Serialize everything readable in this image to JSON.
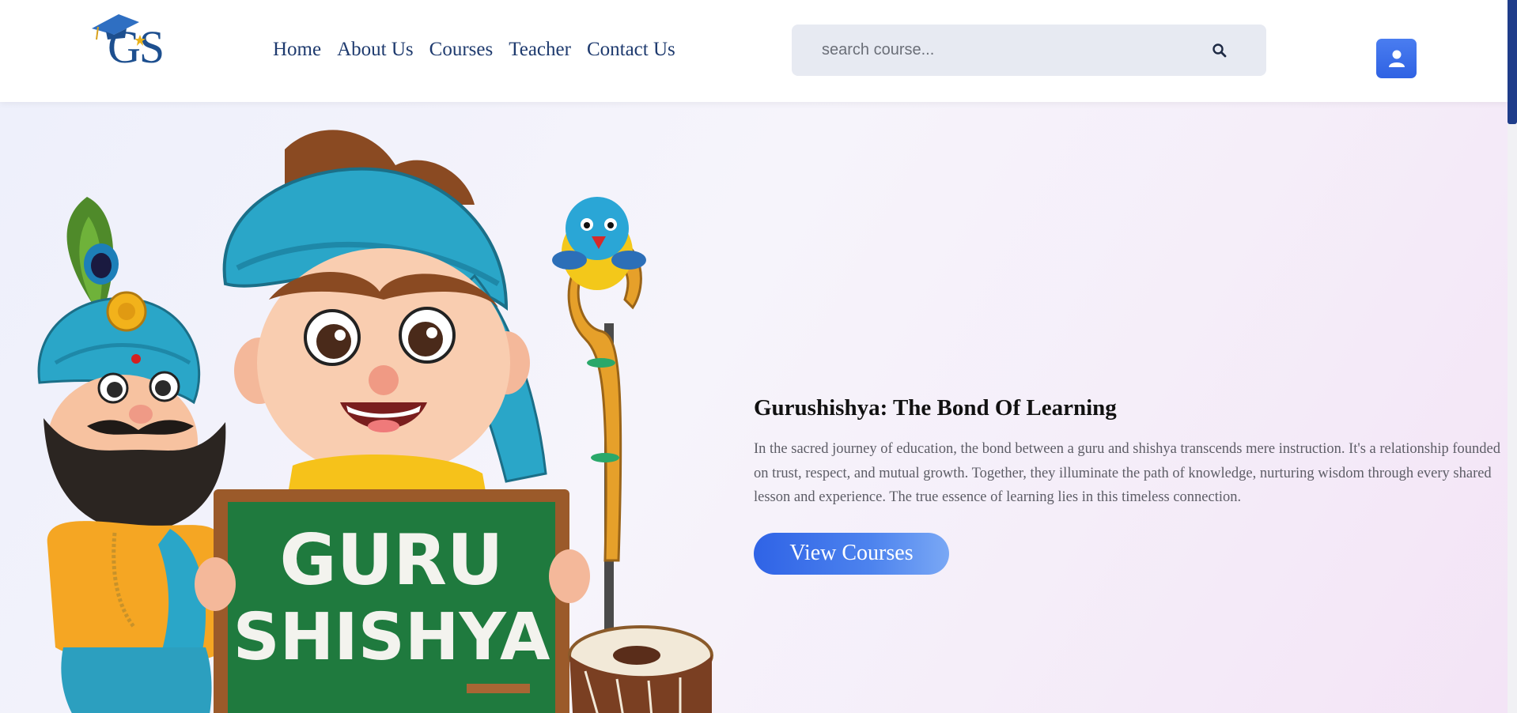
{
  "header": {
    "logo_text": "GS",
    "nav": [
      "Home",
      "About Us",
      "Courses",
      "Teacher",
      "Contact Us"
    ],
    "search": {
      "placeholder": "search course...",
      "icon": "search-icon"
    },
    "user_icon": "user-icon"
  },
  "hero": {
    "chalkboard_line1": "GURU",
    "chalkboard_line2": "SHISHYA",
    "title": "Gurushishya: The Bond Of Learning",
    "text": "In the sacred journey of education, the bond between a guru and shishya transcends mere instruction. It's a relationship founded on trust, respect, and mutual growth. Together, they illuminate the path of knowledge, nurturing wisdom through every shared lesson and experience. The true essence of learning lies in this timeless connection.",
    "button_label": "View Courses"
  },
  "colors": {
    "brand": "#1d4f8f",
    "nav_text": "#1e3a6e",
    "button": "#2f63e6",
    "scroll_thumb": "#1f3d8a"
  }
}
